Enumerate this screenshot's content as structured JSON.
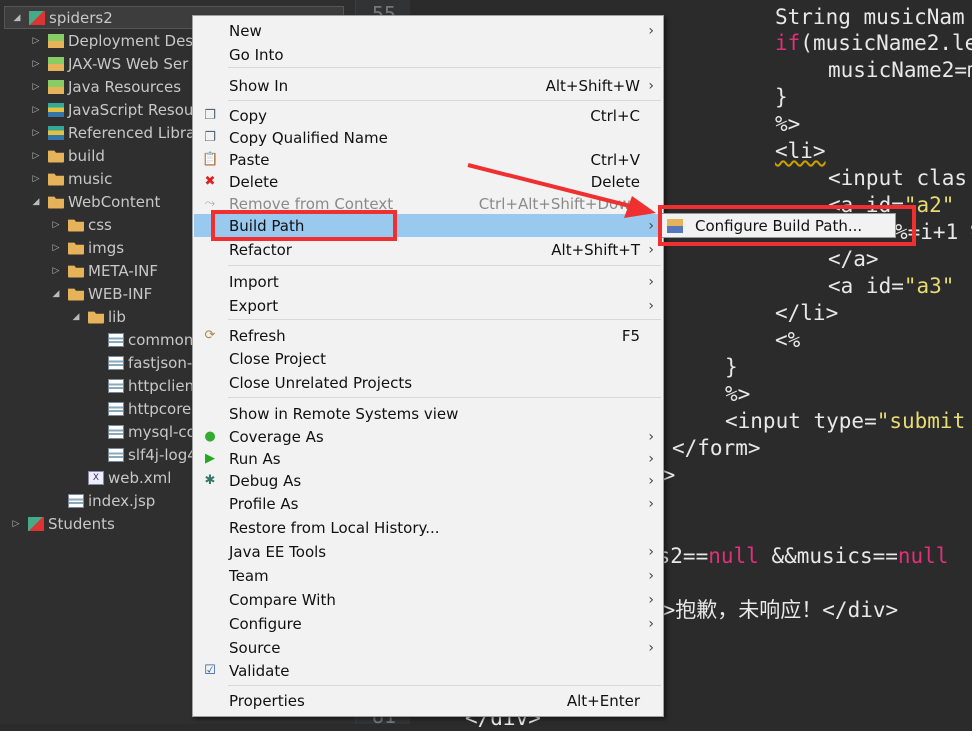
{
  "tree": [
    {
      "label": "spiders2",
      "icon": "project-icon",
      "twisty": "expanded",
      "selected": true
    },
    {
      "label": "Deployment Desc",
      "icon": "deployment-descriptor-icon",
      "twisty": "collapsed"
    },
    {
      "label": "JAX-WS Web Ser",
      "icon": "web-services-icon",
      "twisty": "collapsed"
    },
    {
      "label": "Java Resources",
      "icon": "java-resources-icon",
      "twisty": "collapsed"
    },
    {
      "label": "JavaScript Resou",
      "icon": "javascript-resources-icon",
      "twisty": "collapsed"
    },
    {
      "label": "Referenced Libra",
      "icon": "library-icon",
      "twisty": "collapsed"
    },
    {
      "label": "build",
      "icon": "folder-icon",
      "twisty": "collapsed"
    },
    {
      "label": "music",
      "icon": "folder-icon",
      "twisty": "collapsed"
    },
    {
      "label": "WebContent",
      "icon": "folder-icon",
      "twisty": "expanded"
    },
    {
      "label": "css",
      "icon": "folder-icon",
      "twisty": "collapsed"
    },
    {
      "label": "imgs",
      "icon": "folder-icon",
      "twisty": "collapsed"
    },
    {
      "label": "META-INF",
      "icon": "folder-icon",
      "twisty": "collapsed"
    },
    {
      "label": "WEB-INF",
      "icon": "folder-icon",
      "twisty": "expanded"
    },
    {
      "label": "lib",
      "icon": "folder-icon",
      "twisty": "expanded"
    },
    {
      "label": "common",
      "icon": "jar-icon",
      "twisty": ""
    },
    {
      "label": "fastjson-",
      "icon": "jar-icon",
      "twisty": ""
    },
    {
      "label": "httpclien",
      "icon": "jar-icon",
      "twisty": ""
    },
    {
      "label": "httpcore",
      "icon": "jar-icon",
      "twisty": ""
    },
    {
      "label": "mysql-co",
      "icon": "jar-icon",
      "twisty": ""
    },
    {
      "label": "slf4j-log4",
      "icon": "jar-icon",
      "twisty": ""
    },
    {
      "label": "web.xml",
      "icon": "xml-file-icon",
      "twisty": ""
    },
    {
      "label": "index.jsp",
      "icon": "jsp-file-icon",
      "twisty": ""
    },
    {
      "label": "Students",
      "icon": "project-icon",
      "twisty": "collapsed"
    }
  ],
  "gutter": {
    "top": "55",
    "bottom": "81"
  },
  "code": {
    "l1a": "String musicNam",
    "l2a": "if",
    "l2b": "(musicName2.le",
    "l3": "musicName2=m",
    "l4": "}",
    "l5": "%>",
    "l6": "<li>",
    "l7": "<input clas",
    "l8a": "<a id=",
    "l8b": "\"a2\"",
    "l9": "%=i+1 %",
    "l10": "</a>",
    "l11a": "<a id=",
    "l11b": "\"a3\"",
    "l12": "</li>",
    "l13": "<%",
    "l14": "}",
    "l15": "%>",
    "l16a": "<input type=",
    "l16b": "\"submit",
    "l17": "</form>",
    "l18": "l>",
    "l19a": "cs2==",
    "l19b": "null",
    "l19c": " &&musics==",
    "l19d": "null",
    "l20": "v>抱歉，未响应！</div>",
    "l21": "</div>"
  },
  "menu": [
    {
      "label": "New",
      "submenu": true
    },
    {
      "label": "Go Into"
    },
    {
      "label": "Show In",
      "shortcut": "Alt+Shift+W",
      "submenu": true
    },
    {
      "label": "Copy",
      "shortcut": "Ctrl+C",
      "icon": "copy-icon"
    },
    {
      "label": "Copy Qualified Name",
      "icon": "copy-qualified-name-icon"
    },
    {
      "label": "Paste",
      "shortcut": "Ctrl+V",
      "icon": "paste-icon"
    },
    {
      "label": "Delete",
      "shortcut": "Delete",
      "icon": "delete-icon"
    },
    {
      "label": "Remove from Context",
      "shortcut": "Ctrl+Alt+Shift+Down",
      "disabled": true,
      "icon": "remove-context-icon"
    },
    {
      "label": "Build Path",
      "submenu": true,
      "highlighted": true
    },
    {
      "label": "Refactor",
      "shortcut": "Alt+Shift+T",
      "submenu": true
    },
    {
      "label": "Import",
      "submenu": true
    },
    {
      "label": "Export",
      "submenu": true
    },
    {
      "label": "Refresh",
      "shortcut": "F5",
      "icon": "refresh-icon"
    },
    {
      "label": "Close Project"
    },
    {
      "label": "Close Unrelated Projects"
    },
    {
      "label": "Show in Remote Systems view"
    },
    {
      "label": "Coverage As",
      "submenu": true,
      "icon": "coverage-icon"
    },
    {
      "label": "Run As",
      "submenu": true,
      "icon": "run-icon"
    },
    {
      "label": "Debug As",
      "submenu": true,
      "icon": "debug-icon"
    },
    {
      "label": "Profile As",
      "submenu": true
    },
    {
      "label": "Restore from Local History..."
    },
    {
      "label": "Java EE Tools",
      "submenu": true
    },
    {
      "label": "Team",
      "submenu": true
    },
    {
      "label": "Compare With",
      "submenu": true
    },
    {
      "label": "Configure",
      "submenu": true
    },
    {
      "label": "Source",
      "submenu": true
    },
    {
      "label": "Validate",
      "icon": "checkbox-icon"
    },
    {
      "label": "Properties",
      "shortcut": "Alt+Enter"
    }
  ],
  "submenu": {
    "label": "Configure Build Path...",
    "icon": "build-path-icon"
  },
  "colors": {
    "highlight": "#99c9ef",
    "annotation": "#f03030",
    "keyword": "#e0307a",
    "string": "#e6db74"
  }
}
